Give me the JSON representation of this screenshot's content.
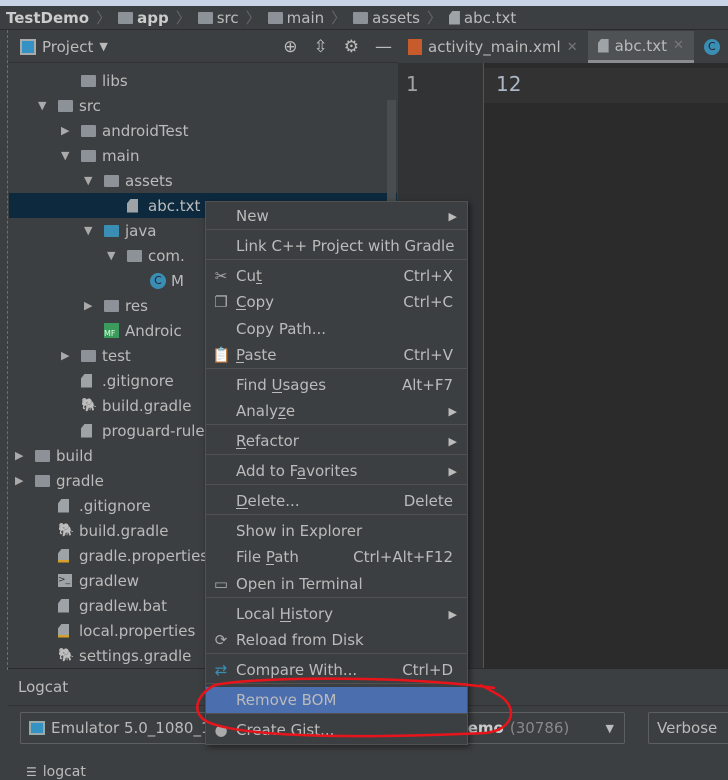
{
  "breadcrumb": [
    "TestDemo",
    "app",
    "src",
    "main",
    "assets",
    "abc.txt"
  ],
  "project_panel": {
    "title": "Project"
  },
  "tree": [
    {
      "label": "libs",
      "type": "folder",
      "indent": 3
    },
    {
      "label": "src",
      "type": "folder",
      "indent": 2,
      "expanded": true
    },
    {
      "label": "androidTest",
      "type": "folder",
      "indent": 3,
      "expanded": false
    },
    {
      "label": "main",
      "type": "folder",
      "indent": 3,
      "expanded": true
    },
    {
      "label": "assets",
      "type": "assets",
      "indent": 4,
      "expanded": true
    },
    {
      "label": "abc.txt",
      "type": "file",
      "indent": 5,
      "selected": true
    },
    {
      "label": "java",
      "type": "java",
      "indent": 4,
      "expanded": true
    },
    {
      "label": "com.",
      "type": "package",
      "indent": 5,
      "expanded": true
    },
    {
      "label": "M",
      "type": "class",
      "indent": 6
    },
    {
      "label": "res",
      "type": "assets",
      "indent": 4,
      "expanded": false
    },
    {
      "label": "Androic",
      "type": "manifest",
      "indent": 4
    },
    {
      "label": "test",
      "type": "folder",
      "indent": 3,
      "expanded": false
    },
    {
      "label": ".gitignore",
      "type": "gitignore",
      "indent": 3
    },
    {
      "label": "build.gradle",
      "type": "gradle",
      "indent": 3
    },
    {
      "label": "proguard-rule",
      "type": "file",
      "indent": 3
    },
    {
      "label": "build",
      "type": "folder",
      "indent": 1,
      "expanded": false
    },
    {
      "label": "gradle",
      "type": "folder",
      "indent": 1,
      "expanded": false
    },
    {
      "label": ".gitignore",
      "type": "gitignore",
      "indent": 2
    },
    {
      "label": "build.gradle",
      "type": "gradle",
      "indent": 2
    },
    {
      "label": "gradle.properties",
      "type": "props",
      "indent": 2
    },
    {
      "label": "gradlew",
      "type": "terminal",
      "indent": 2
    },
    {
      "label": "gradlew.bat",
      "type": "file",
      "indent": 2
    },
    {
      "label": "local.properties",
      "type": "props",
      "indent": 2
    },
    {
      "label": "settings.gradle",
      "type": "gradle",
      "indent": 2
    }
  ],
  "tabs": [
    {
      "label": "activity_main.xml"
    },
    {
      "label": "abc.txt",
      "active": true
    }
  ],
  "editor": {
    "line_number": "1",
    "content": "12"
  },
  "logcat": {
    "title": "Logcat",
    "device": "Emulator 5.0_1080_19",
    "process_name": "demo",
    "process_pid": "(30786)",
    "level": "Verbose",
    "tab": "logcat"
  },
  "menu": {
    "items": [
      {
        "label": "New",
        "submenu": true
      },
      {
        "label": "Link C++ Project with Gradle"
      },
      {
        "label": "Cut",
        "shortcut": "Ctrl+X",
        "icon": "scissors-icon"
      },
      {
        "label": "Copy",
        "shortcut": "Ctrl+C",
        "icon": "copy-icon"
      },
      {
        "label": "Copy Path..."
      },
      {
        "label": "Paste",
        "shortcut": "Ctrl+V",
        "icon": "clipboard-icon"
      },
      {
        "label": "Find Usages",
        "shortcut": "Alt+F7"
      },
      {
        "label": "Analyze",
        "submenu": true
      },
      {
        "label": "Refactor",
        "submenu": true
      },
      {
        "label": "Add to Favorites",
        "submenu": true
      },
      {
        "label": "Delete...",
        "shortcut": "Delete"
      },
      {
        "label": "Show in Explorer"
      },
      {
        "label": "File Path",
        "shortcut": "Ctrl+Alt+F12"
      },
      {
        "label": "Open in Terminal",
        "icon": "terminal-icon"
      },
      {
        "label": "Local History",
        "submenu": true
      },
      {
        "label": "Reload from Disk",
        "icon": "reload-icon"
      },
      {
        "label": "Compare With...",
        "shortcut": "Ctrl+D",
        "icon": "compare-icon"
      },
      {
        "label": "Remove BOM",
        "highlighted": true
      },
      {
        "label": "Create Gist...",
        "icon": "github-icon"
      }
    ]
  },
  "colors": {
    "accent": "#4b6eaf",
    "annotation": "#e8141b",
    "selection": "#0d293e"
  }
}
